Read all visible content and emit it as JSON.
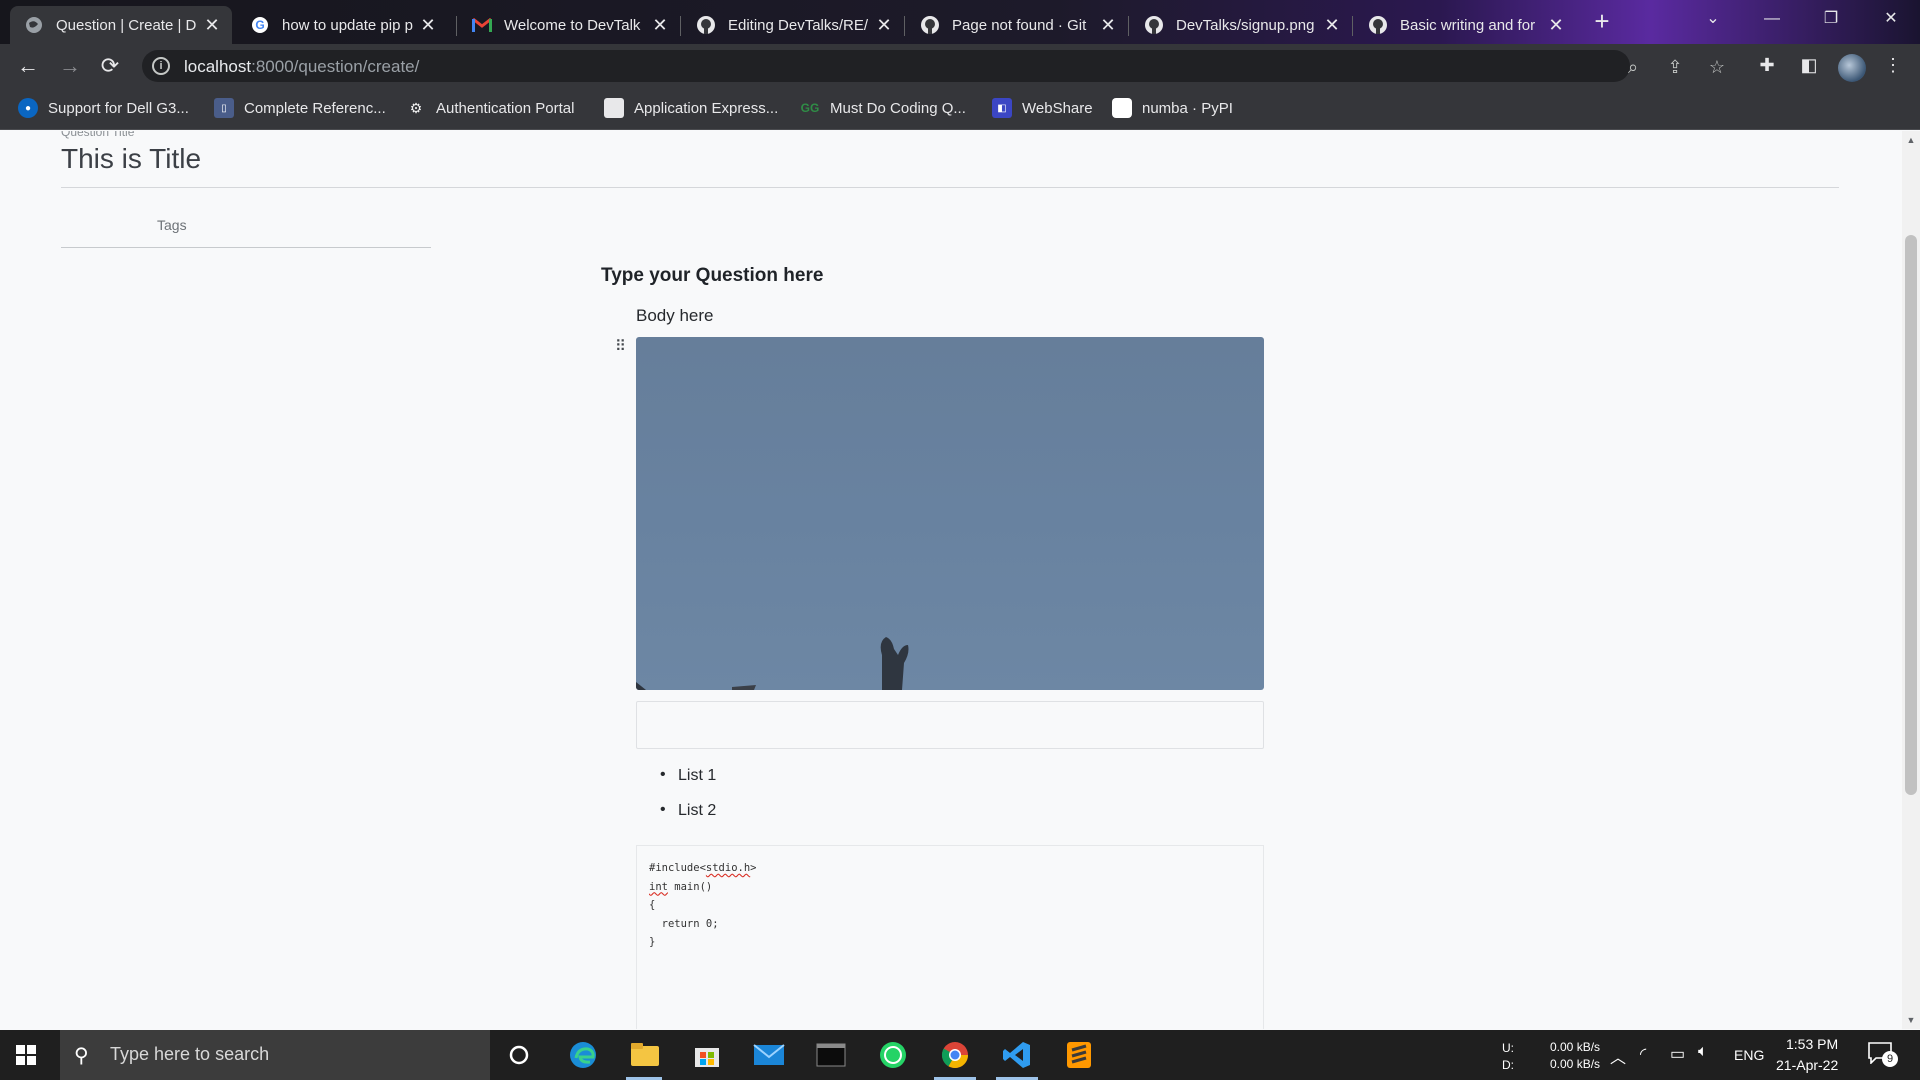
{
  "browser": {
    "tabs": [
      {
        "label": "Question | Create | D",
        "icon": "globe-icon",
        "active": true
      },
      {
        "label": "how to update pip p",
        "icon": "google-icon"
      },
      {
        "label": "Welcome to DevTalk",
        "icon": "gmail-icon"
      },
      {
        "label": "Editing DevTalks/RE/",
        "icon": "github-icon"
      },
      {
        "label": "Page not found · Git",
        "icon": "github-icon"
      },
      {
        "label": "DevTalks/signup.png",
        "icon": "github-icon"
      },
      {
        "label": "Basic writing and for",
        "icon": "github-icon"
      }
    ],
    "new_tab": "+",
    "url_host": "localhost",
    "url_path": ":8000/question/create/",
    "bookmarks": [
      {
        "label": "Support for Dell G3...",
        "icon": "dell-icon"
      },
      {
        "label": "Complete Referenc...",
        "icon": "doc-icon"
      },
      {
        "label": "Authentication Portal",
        "icon": "portal-icon"
      },
      {
        "label": "Application Express...",
        "icon": "page-icon"
      },
      {
        "label": "Must Do Coding Q...",
        "icon": "gfg-icon"
      },
      {
        "label": "WebShare",
        "icon": "webshare-icon"
      },
      {
        "label": "numba · PyPI",
        "icon": "pypi-icon"
      }
    ]
  },
  "page": {
    "title_label": "Question Title",
    "title_value": "This is Title",
    "tags_label": "Tags",
    "question_heading": "Type your Question here",
    "body_text": "Body here",
    "list_items": [
      "List 1",
      "List 2"
    ],
    "code_lines": [
      "#include<stdio.h>",
      "int main()",
      "{",
      "  return 0;",
      "}"
    ]
  },
  "taskbar": {
    "search_placeholder": "Type here to search",
    "net_upload_label": "U:",
    "net_download_label": "D:",
    "net_upload": "0.00 kB/s",
    "net_download": "0.00 kB/s",
    "language": "ENG",
    "time": "1:53 PM",
    "date": "21-Apr-22",
    "notification_count": "9"
  }
}
